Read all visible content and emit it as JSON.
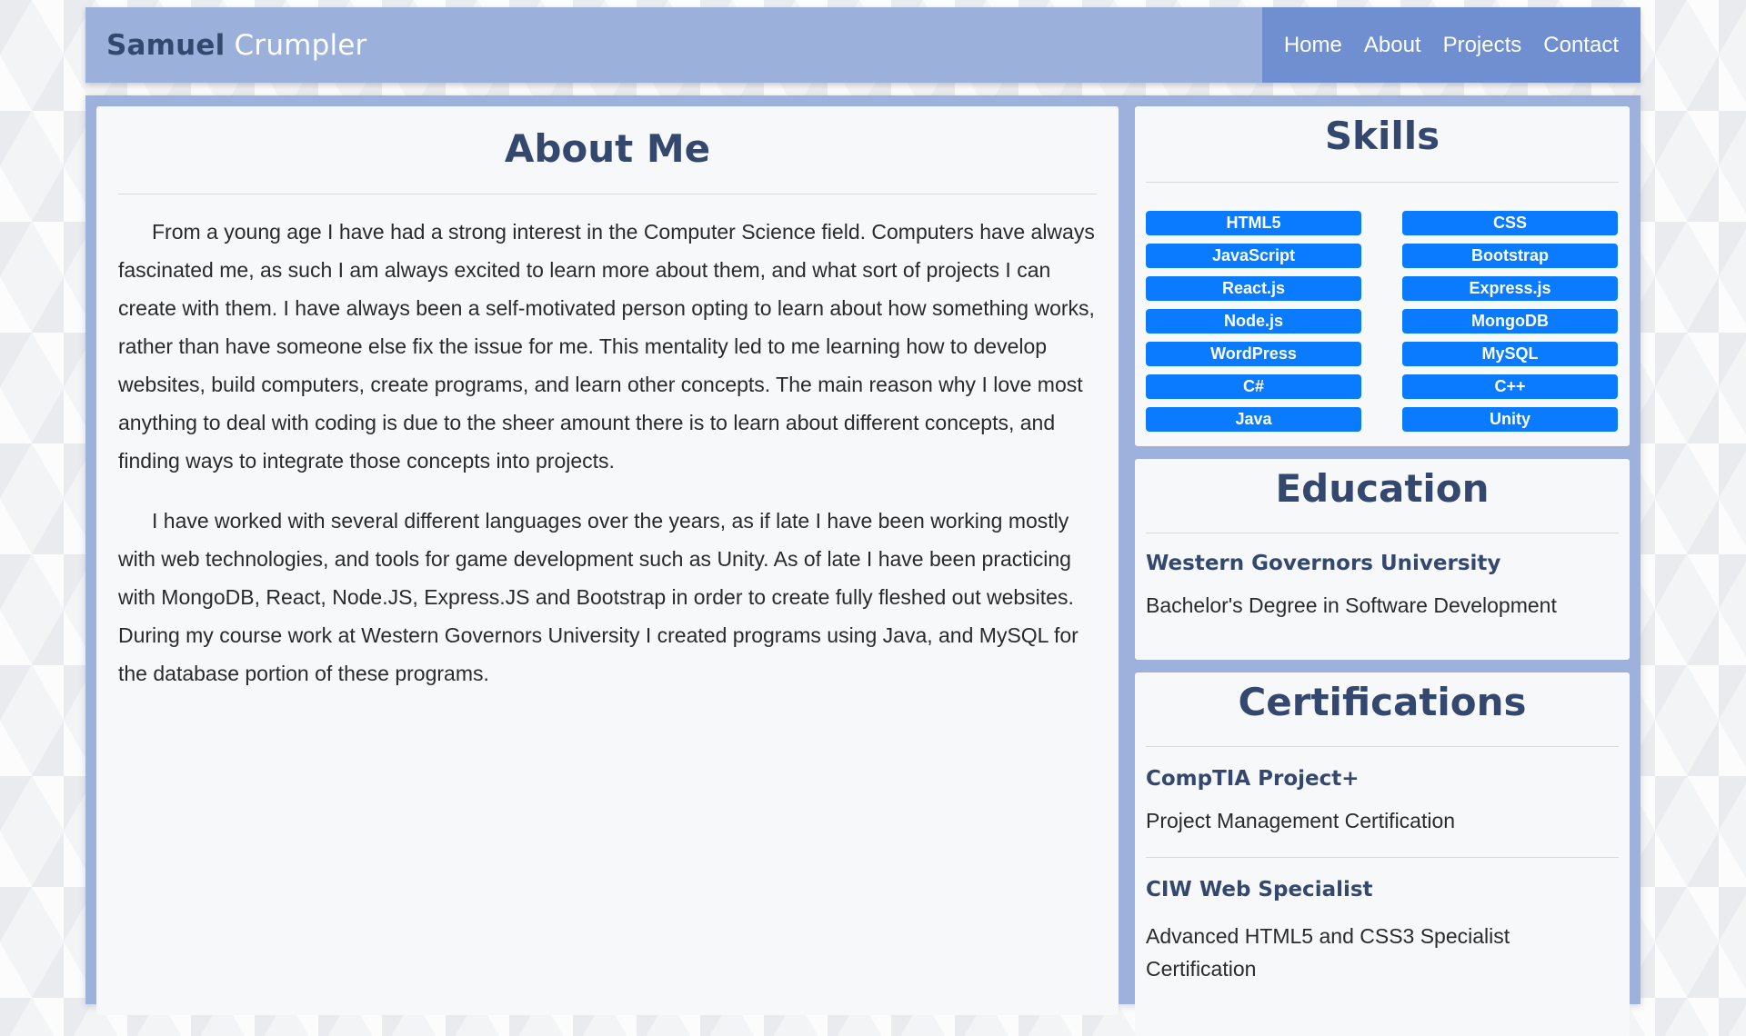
{
  "navbar": {
    "brand_first": "Samuel",
    "brand_last": "Crumpler",
    "links": [
      {
        "label": "Home"
      },
      {
        "label": "About"
      },
      {
        "label": "Projects"
      },
      {
        "label": "Contact"
      }
    ]
  },
  "about": {
    "title": "About Me",
    "paragraphs": [
      "From a young age I have had a strong interest in the Computer Science field. Computers have always fascinated me, as such I am always excited to learn more about them, and what sort of projects I can create with them. I have always been a self-motivated person opting to learn about how something works, rather than have someone else fix the issue for me. This mentality led to me learning how to develop websites, build computers, create programs, and learn other concepts. The main reason why I love most anything to deal with coding is due to the sheer amount there is to learn about different concepts, and finding ways to integrate those concepts into projects.",
      "I have worked with several different languages over the years, as if late I have been working mostly with web technologies, and tools for game development such as Unity. As of late I have been practicing with MongoDB, React, Node.JS, Express.JS and Bootstrap in order to create fully fleshed out websites. During my course work at Western Governors University I created programs using Java, and MySQL for the database portion of these programs."
    ]
  },
  "skills": {
    "title": "Skills",
    "items": [
      "HTML5",
      "CSS",
      "JavaScript",
      "Bootstrap",
      "React.js",
      "Express.js",
      "Node.js",
      "MongoDB",
      "WordPress",
      "MySQL",
      "C#",
      "C++",
      "Java",
      "Unity"
    ]
  },
  "education": {
    "title": "Education",
    "school": "Western Governors University",
    "degree": "Bachelor's Degree in Software Development"
  },
  "certifications": {
    "title": "Certifications",
    "items": [
      {
        "name": "CompTIA Project+",
        "description": "Project Management Certification"
      },
      {
        "name": "CIW Web Specialist",
        "description": "Advanced HTML5 and CSS3 Specialist Certification"
      }
    ]
  },
  "colors": {
    "navbar_bg": "#9bb0db",
    "nav_links_bg": "#6f8fd0",
    "heading_text": "#34486f",
    "skill_badge": "#0a7bff"
  }
}
